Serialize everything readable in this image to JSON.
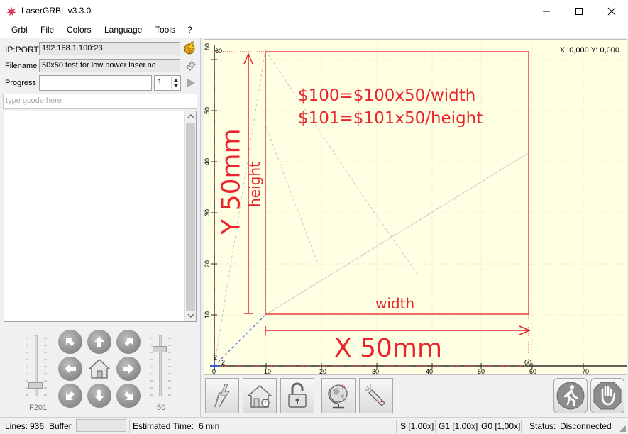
{
  "window": {
    "title": "LaserGRBL v3.3.0"
  },
  "menu": {
    "items": [
      "Grbl",
      "File",
      "Colors",
      "Language",
      "Tools",
      "?"
    ]
  },
  "connection": {
    "ip_label": "IP:PORT",
    "ip_value": "192.168.1.100:23",
    "filename_label": "Filename",
    "filename_value": "50x50 test for low power laser.nc",
    "progress_label": "Progress",
    "copies": "1"
  },
  "gcode": {
    "placeholder": "type gcode here"
  },
  "sliders": {
    "feed_label": "F201",
    "power_label": "50"
  },
  "canvas": {
    "coords": "X: 0,000 Y: 0,000",
    "formula1": "$100=$100x50/width",
    "formula2": "$101=$101x50/height",
    "height_label": "height",
    "width_label": "width",
    "y_label": "Y 50mm",
    "x_label": "X 50mm",
    "x_ticks": [
      "0",
      "10",
      "20",
      "30",
      "40",
      "50",
      "60",
      "70"
    ],
    "y_ticks": [
      "10",
      "20",
      "30",
      "40",
      "50",
      "60"
    ],
    "corner_top_left": "60",
    "corner_right": "60",
    "corner_origin_x": "2",
    "corner_origin_y": "2",
    "line_color": "#e8242d"
  },
  "toolbar": {
    "left": [
      "connect-icon",
      "home-icon",
      "unlock-icon",
      "globe-icon",
      "laser-icon"
    ],
    "right": [
      "run-icon",
      "stop-hand-icon"
    ]
  },
  "status": {
    "lines_label": "Lines:",
    "lines_value": "936",
    "buffer_label": "Buffer",
    "estimated_label": "Estimated Time:",
    "estimated_value": "6 min",
    "s_override": "S [1,00x]",
    "g1_override": "G1 [1,00x]",
    "g0_override": "G0 [1,00x]",
    "status_label": "Status:",
    "status_value": "Disconnected"
  }
}
